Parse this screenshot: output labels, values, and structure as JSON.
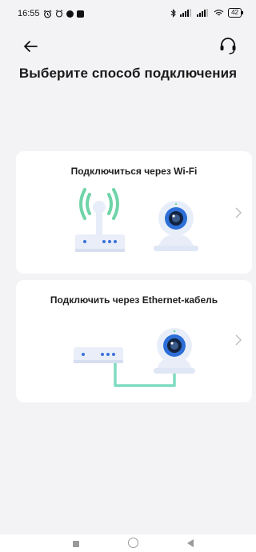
{
  "status_bar": {
    "time": "16:55",
    "battery": "42"
  },
  "header": {
    "title": "Выберите способ подключения"
  },
  "options": [
    {
      "title": "Подключиться через Wi-Fi",
      "icon": "wifi-router-camera-illustration"
    },
    {
      "title": "Подключить через Ethernet-кабель",
      "icon": "ethernet-router-camera-illustration"
    }
  ],
  "colors": {
    "accent_green": "#7ed6b8",
    "accent_blue": "#2d6fd8",
    "background": "#f3f3f5"
  }
}
